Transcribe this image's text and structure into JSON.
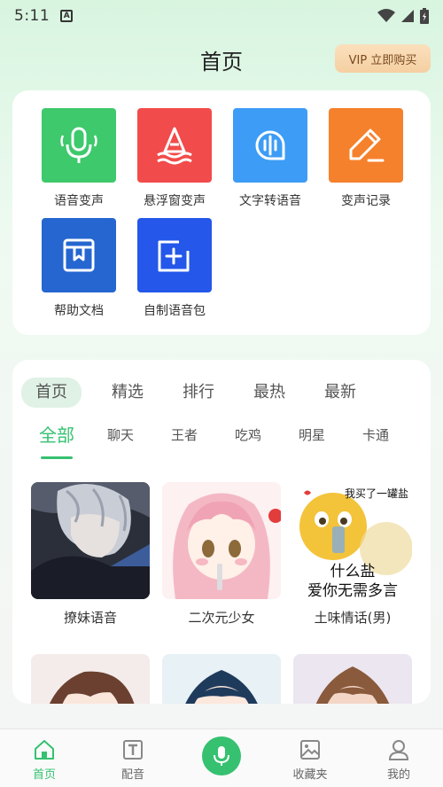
{
  "status": {
    "time": "5:11"
  },
  "header": {
    "title": "首页",
    "vip_label": "VIP 立即购买"
  },
  "tools": [
    {
      "label": "语音变声",
      "icon": "microphone-icon",
      "color": "#3ec96c"
    },
    {
      "label": "悬浮窗变声",
      "icon": "sailboat-icon",
      "color": "#f24b4b"
    },
    {
      "label": "文字转语音",
      "icon": "text-speech-icon",
      "color": "#3d9cf5"
    },
    {
      "label": "变声记录",
      "icon": "pen-icon",
      "color": "#f5812c"
    },
    {
      "label": "帮助文档",
      "icon": "book-icon",
      "color": "#2566d0"
    },
    {
      "label": "自制语音包",
      "icon": "add-square-icon",
      "color": "#2457ea"
    }
  ],
  "tabs": [
    "首页",
    "精选",
    "排行",
    "最热",
    "最新"
  ],
  "subtabs": [
    "全部",
    "聊天",
    "王者",
    "吃鸡",
    "明星",
    "卡通"
  ],
  "items": [
    {
      "caption": "撩妹语音"
    },
    {
      "caption": "二次元少女"
    },
    {
      "caption": "土味情话(男)",
      "overlay_top": "我买了一罐盐",
      "overlay_line1": "什么盐",
      "overlay_line2": "爱你无需多言"
    },
    {
      "caption": ""
    },
    {
      "caption": ""
    },
    {
      "caption": ""
    }
  ],
  "nav": [
    {
      "label": "首页",
      "icon": "home-icon"
    },
    {
      "label": "配音",
      "icon": "dubbing-icon"
    },
    {
      "label": "",
      "icon": "microphone-icon"
    },
    {
      "label": "收藏夹",
      "icon": "image-icon"
    },
    {
      "label": "我的",
      "icon": "user-icon"
    }
  ],
  "accent": "#35c170"
}
